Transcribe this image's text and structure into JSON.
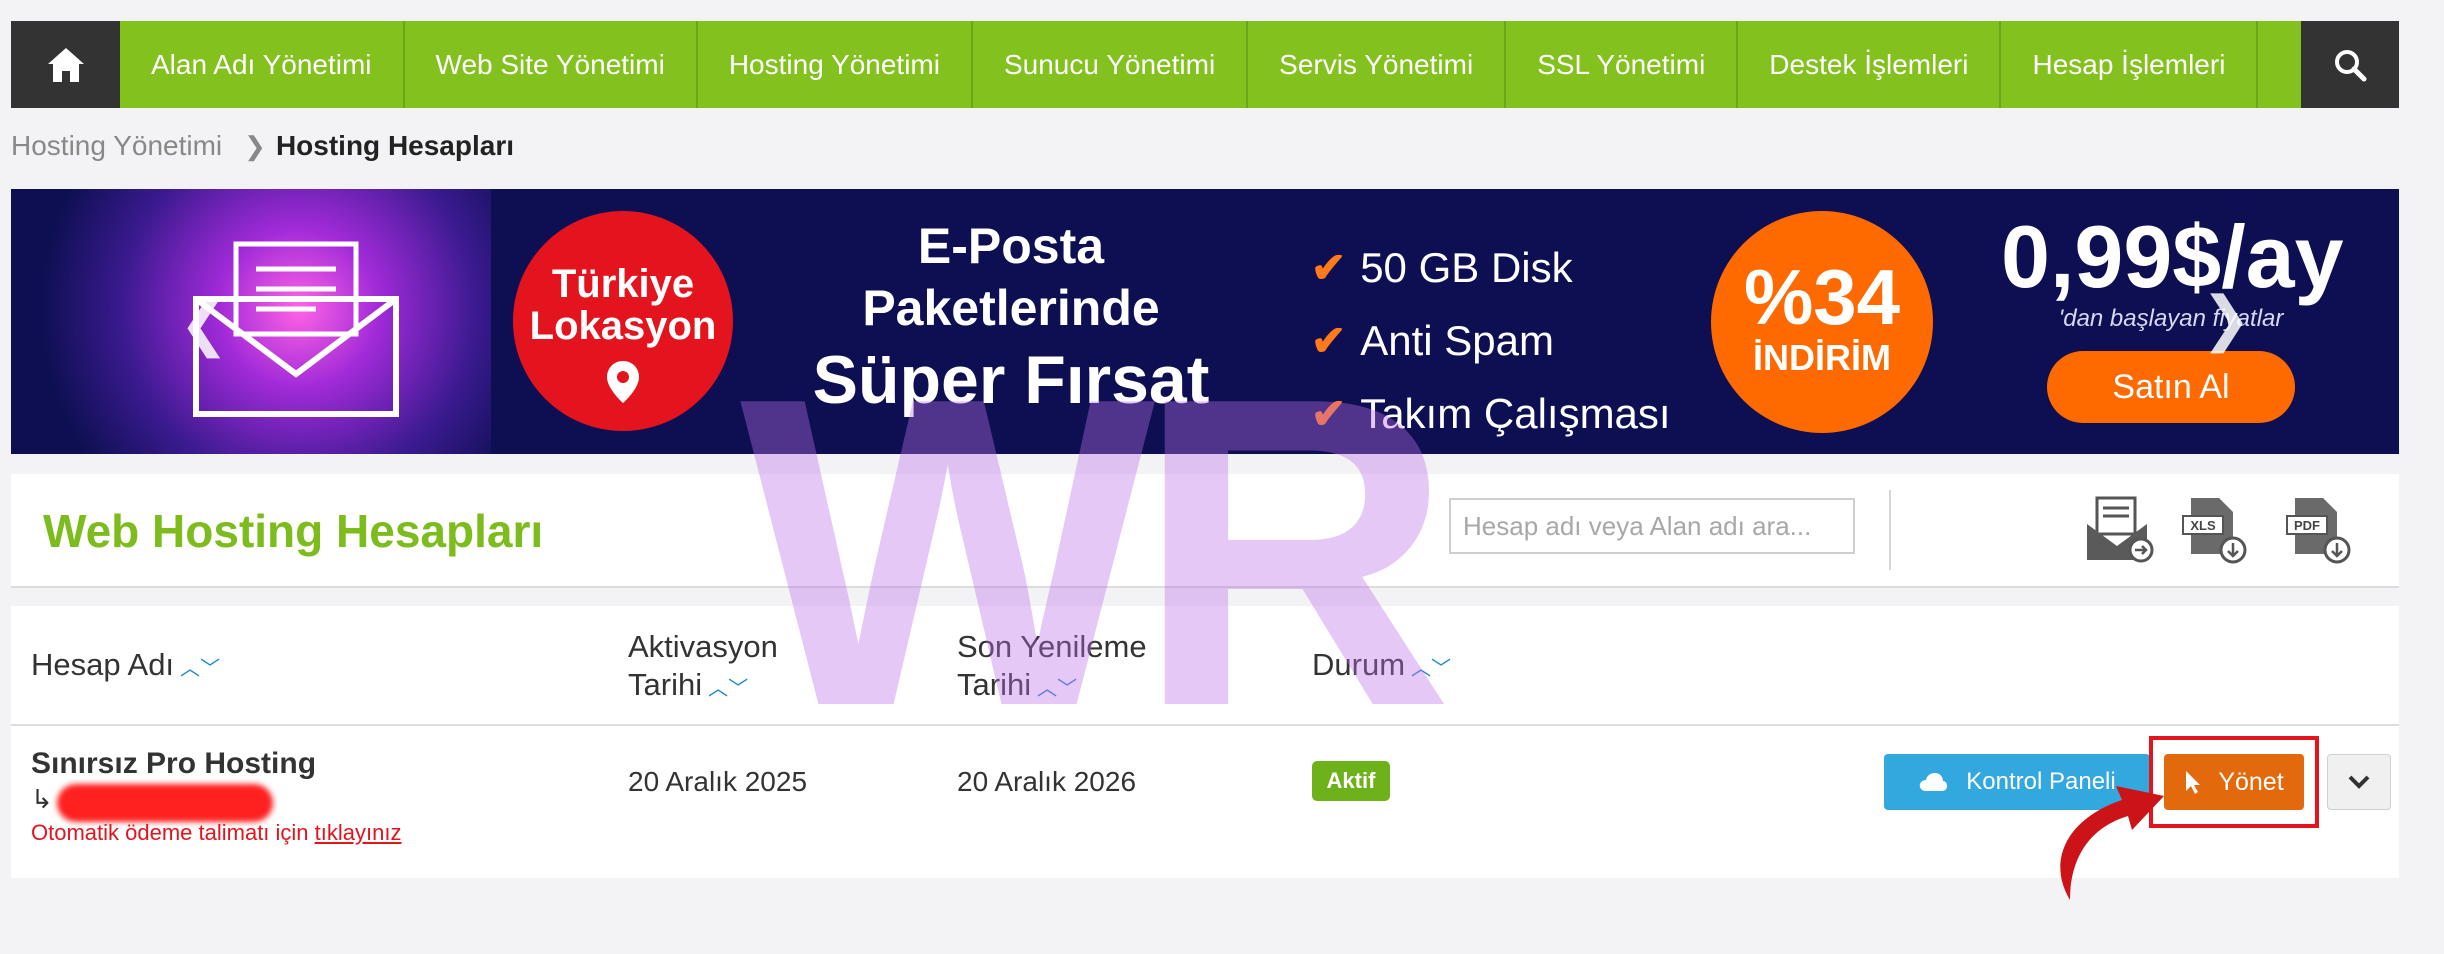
{
  "nav": {
    "items": [
      "Alan Adı Yönetimi",
      "Web Site Yönetimi",
      "Hosting Yönetimi",
      "Sunucu Yönetimi",
      "Servis Yönetimi",
      "SSL Yönetimi",
      "Destek İşlemleri",
      "Hesap İşlemleri"
    ],
    "colors": {
      "accent": "#83c11f",
      "dark": "#333333"
    }
  },
  "breadcrumb": {
    "parent": "Hosting Yönetimi",
    "current": "Hosting Hesapları"
  },
  "banner": {
    "badge_line1": "Türkiye",
    "badge_line2": "Lokasyon",
    "headline1": "E-Posta",
    "headline2": "Paketlerinde",
    "headline3": "Süper Fırsat",
    "features": [
      "50 GB Disk",
      "Anti Spam",
      "Takım Çalışması"
    ],
    "discount_percent": "%34",
    "discount_label": "İNDİRİM",
    "price": "0,99$/ay",
    "price_note": "'dan başlayan fiyatlar",
    "buy_label": "Satın Al"
  },
  "accounts": {
    "title": "Web Hosting Hesapları",
    "search_placeholder": "Hesap adı veya Alan adı ara...",
    "icons": [
      "email-export-icon",
      "xls-download-icon",
      "pdf-download-icon"
    ]
  },
  "table": {
    "headers": {
      "name": "Hesap Adı",
      "activation_line1": "Aktivasyon",
      "activation_line2": "Tarihi",
      "renewal_line1": "Son Yenileme",
      "renewal_line2": "Tarihi",
      "status": "Durum"
    },
    "rows": [
      {
        "name": "Sınırsız Pro Hosting",
        "auto_pay_text": "Otomatik ödeme talimatı için ",
        "auto_pay_link": "tıklayınız",
        "activation": "20 Aralık 2025",
        "renewal": "20 Aralık 2026",
        "status": "Aktif",
        "control_panel_label": "Kontrol Paneli",
        "manage_label": "Yönet"
      }
    ]
  },
  "watermark": "WR"
}
